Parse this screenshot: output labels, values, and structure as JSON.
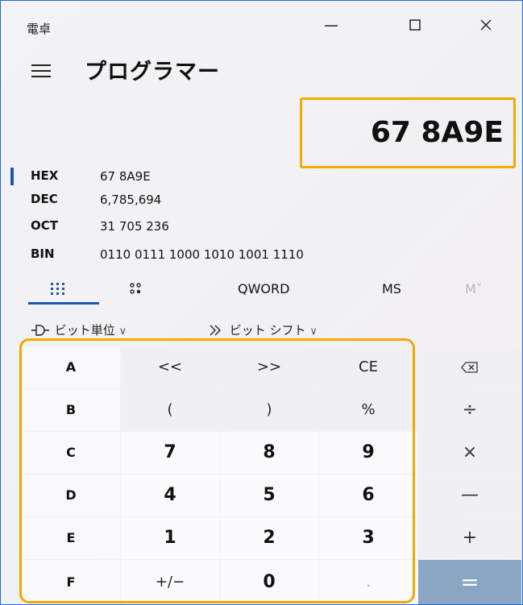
{
  "window": {
    "title": "電卓",
    "minimize_icon": "minimize-icon",
    "maximize_icon": "maximize-icon",
    "close_icon": "close-icon"
  },
  "header": {
    "menu_icon": "hamburger-icon",
    "mode": "プログラマー"
  },
  "display": {
    "value": "67 8A9E"
  },
  "radix": [
    {
      "label": "HEX",
      "value": "67 8A9E",
      "selected": true
    },
    {
      "label": "DEC",
      "value": "6,785,694"
    },
    {
      "label": "OCT",
      "value": "31 705 236"
    },
    {
      "label": "BIN",
      "value": "0110 0111 1000 1010 1001 1110"
    }
  ],
  "tabs": {
    "keypad_icon": "keypad-icon",
    "bit_toggle_icon": "bit-toggle-icon",
    "word_size": "QWORD",
    "ms": "MS",
    "mv": "M˅"
  },
  "options": {
    "bitwise": "ビット単位",
    "bitshift": "ビット シフト"
  },
  "keys": {
    "A": "A",
    "B": "B",
    "C": "C",
    "D": "D",
    "E": "E",
    "F": "F",
    "lshift": "<<",
    "rshift": ">>",
    "ce": "CE",
    "backspace": "⌫",
    "lparen": "(",
    "rparen": ")",
    "percent": "%",
    "divide": "÷",
    "n7": "7",
    "n8": "8",
    "n9": "9",
    "multiply": "×",
    "n4": "4",
    "n5": "5",
    "n6": "6",
    "minus": "—",
    "n1": "1",
    "n2": "2",
    "n3": "3",
    "plus": "+",
    "negate": "+/−",
    "n0": "0",
    "decimal": ".",
    "equals": "="
  },
  "colors": {
    "accent": "#1c57b0",
    "highlight": "#f2a900",
    "equals_bg": "#8aa6c2"
  }
}
